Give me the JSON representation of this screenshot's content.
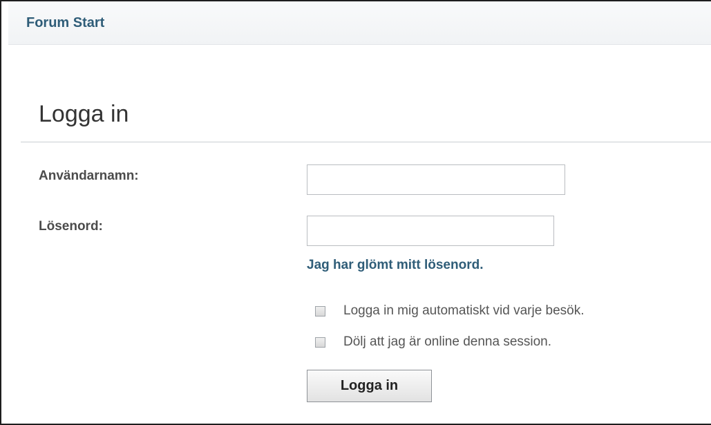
{
  "header": {
    "breadcrumb": "Forum Start"
  },
  "login": {
    "title": "Logga in",
    "username_label": "Användarnamn:",
    "username_value": "",
    "password_label": "Lösenord:",
    "password_value": "",
    "forgot_password": "Jag har glömt mitt lösenord.",
    "autologin_label": "Logga in mig automatiskt vid varje besök.",
    "autologin_checked": false,
    "hide_online_label": "Dölj att jag är online denna session.",
    "hide_online_checked": false,
    "submit_label": "Logga in"
  },
  "colors": {
    "link": "#2f5d78",
    "label": "#4b4b4b",
    "border": "#b9bcc0"
  }
}
